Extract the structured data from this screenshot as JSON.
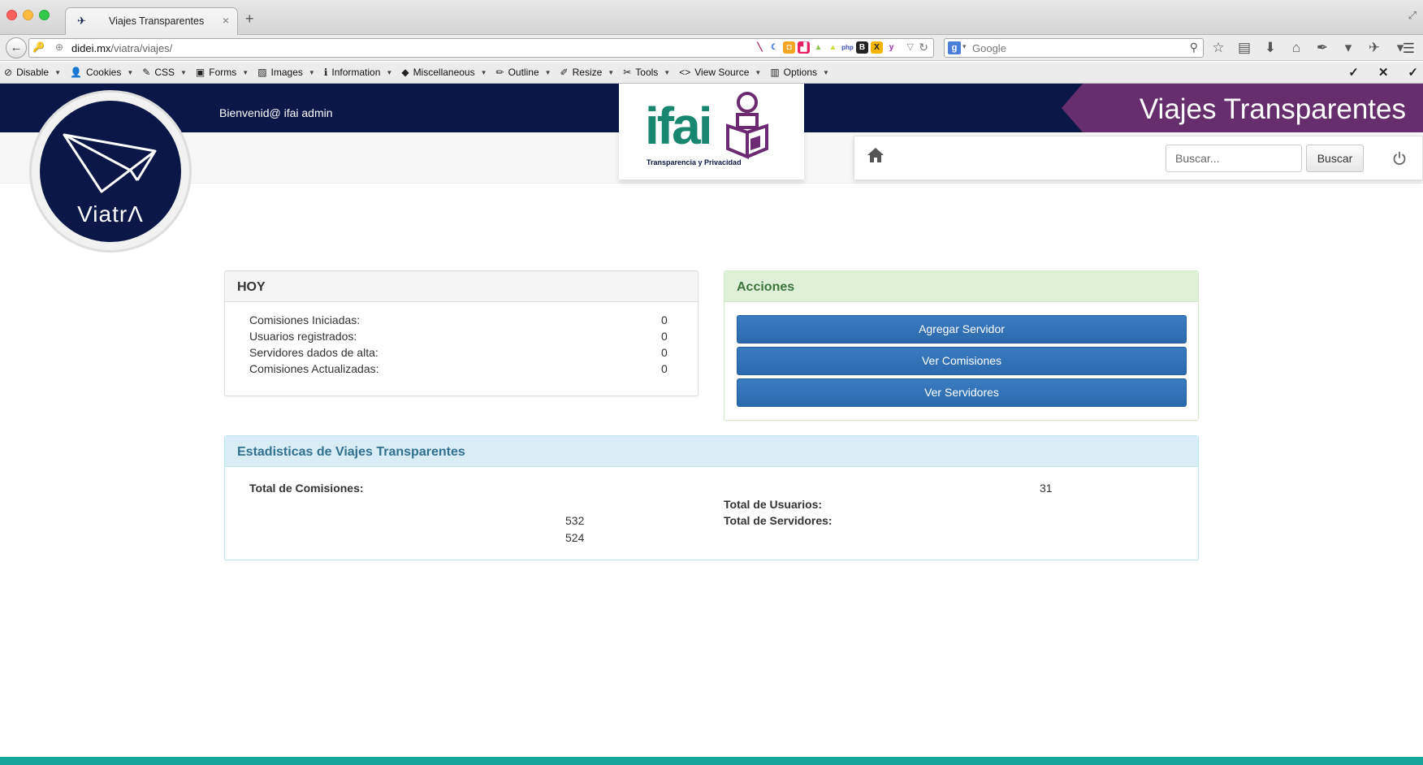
{
  "browser": {
    "tab_title": "Viajes Transparentes",
    "tab_close": "×",
    "new_tab": "+",
    "url_domain": "didei.mx",
    "url_path": "/viatra/viajes/",
    "search_placeholder": "Google"
  },
  "devbar": {
    "items": [
      {
        "label": "Disable",
        "icon": "⊘"
      },
      {
        "label": "Cookies",
        "icon": "👤"
      },
      {
        "label": "CSS",
        "icon": "✎"
      },
      {
        "label": "Forms",
        "icon": "▣"
      },
      {
        "label": "Images",
        "icon": "▨"
      },
      {
        "label": "Information",
        "icon": "ℹ"
      },
      {
        "label": "Miscellaneous",
        "icon": "◆"
      },
      {
        "label": "Outline",
        "icon": "✏"
      },
      {
        "label": "Resize",
        "icon": "✐"
      },
      {
        "label": "Tools",
        "icon": "✂"
      },
      {
        "label": "View Source",
        "icon": "<>"
      },
      {
        "label": "Options",
        "icon": "▥"
      }
    ]
  },
  "header": {
    "welcome": "Bienvenid@ ifai admin",
    "brand_title": "Viajes Transparentes",
    "ifai_word": "ifai",
    "ifai_tagline": "Transparencia y Privacidad",
    "viatra_word": "ViatrΛ",
    "search_placeholder": "Buscar...",
    "search_button": "Buscar",
    "colors": {
      "navy": "#0b1746",
      "purple": "#672e6d",
      "green": "#19876f",
      "teal": "#16a59a"
    }
  },
  "hoy": {
    "title": "HOY",
    "rows": [
      {
        "label": "Comisiones Iniciadas:",
        "value": "0"
      },
      {
        "label": "Usuarios registrados:",
        "value": "0"
      },
      {
        "label": "Servidores dados de alta:",
        "value": "0"
      },
      {
        "label": "Comisiones Actualizadas:",
        "value": "0"
      }
    ]
  },
  "acciones": {
    "title": "Acciones",
    "buttons": [
      "Agregar Servidor",
      "Ver Comisiones",
      "Ver Servidores"
    ]
  },
  "estadisticas": {
    "title": "Estadisticas de Viajes Transparentes",
    "total_comisiones_label": "Total de Comisiones:",
    "total_usuarios_label": "Total de Usuarios:",
    "total_servidores_label": "Total de Servidores:",
    "value_31": "31",
    "value_532": "532",
    "value_524": "524"
  }
}
